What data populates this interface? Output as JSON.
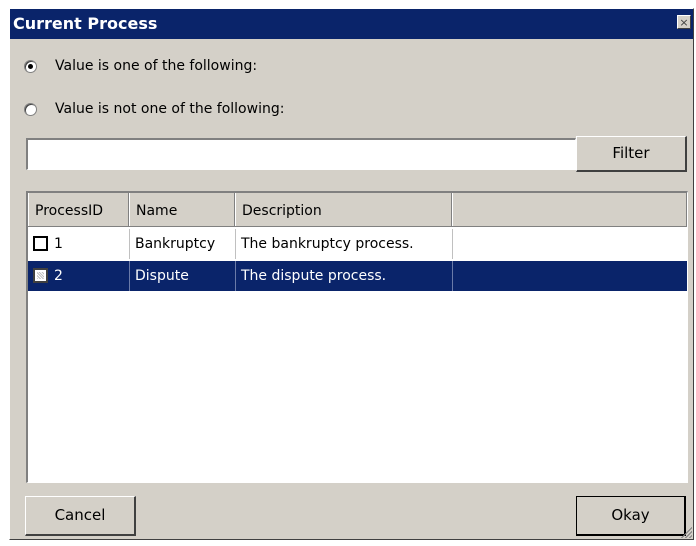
{
  "window": {
    "title": "Current Process",
    "close_glyph": "×"
  },
  "filter_mode": {
    "options": [
      {
        "label": "Value is one of the following:",
        "selected": true
      },
      {
        "label": "Value is not one of the following:",
        "selected": false
      }
    ]
  },
  "filter": {
    "input_value": "",
    "button_label": "Filter"
  },
  "table": {
    "columns": [
      "ProcessID",
      "Name",
      "Description"
    ],
    "rows": [
      {
        "id": "1",
        "name": "Bankruptcy",
        "description": "The bankruptcy process.",
        "checked": false,
        "selected": false
      },
      {
        "id": "2",
        "name": "Dispute",
        "description": "The dispute process.",
        "checked": false,
        "selected": true
      }
    ]
  },
  "footer": {
    "cancel_label": "Cancel",
    "okay_label": "Okay"
  },
  "colors": {
    "titlebar": "#0a246a",
    "selection": "#0a246a",
    "dialog_bg": "#d4d0c8"
  },
  "icons": {
    "close": "close-icon",
    "resize": "resize-grip-icon"
  }
}
